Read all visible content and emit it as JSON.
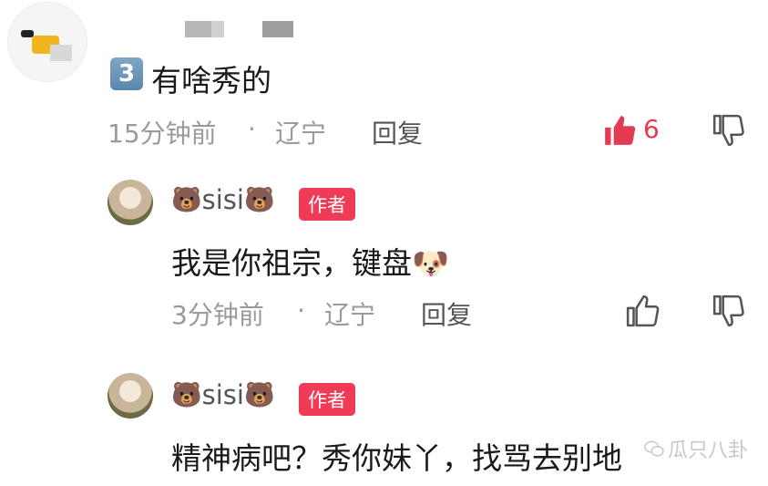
{
  "top_comment": {
    "rank": "3",
    "text": "有啥秀的",
    "time": "15分钟前",
    "location": "辽宁",
    "reply_label": "回复",
    "like_count": "6",
    "liked": true
  },
  "replies": [
    {
      "username": "sisi",
      "bear_emoji": "🐻",
      "badge": "作者",
      "text": "我是你祖宗，键盘",
      "emoji": "🐶",
      "time": "3分钟前",
      "location": "辽宁",
      "reply_label": "回复"
    },
    {
      "username": "sisi",
      "bear_emoji": "🐻",
      "badge": "作者",
      "text": "精神病吧？秀你妹丫，找骂去别地"
    }
  ],
  "separator": "·",
  "watermark": "瓜只八卦",
  "colors": {
    "accent_red": "#ef3b56",
    "meta_gray": "#9a9a9a"
  },
  "icons": {
    "like": "thumbs-up-icon",
    "dislike": "thumbs-down-icon",
    "watermark": "wechat-icon"
  }
}
